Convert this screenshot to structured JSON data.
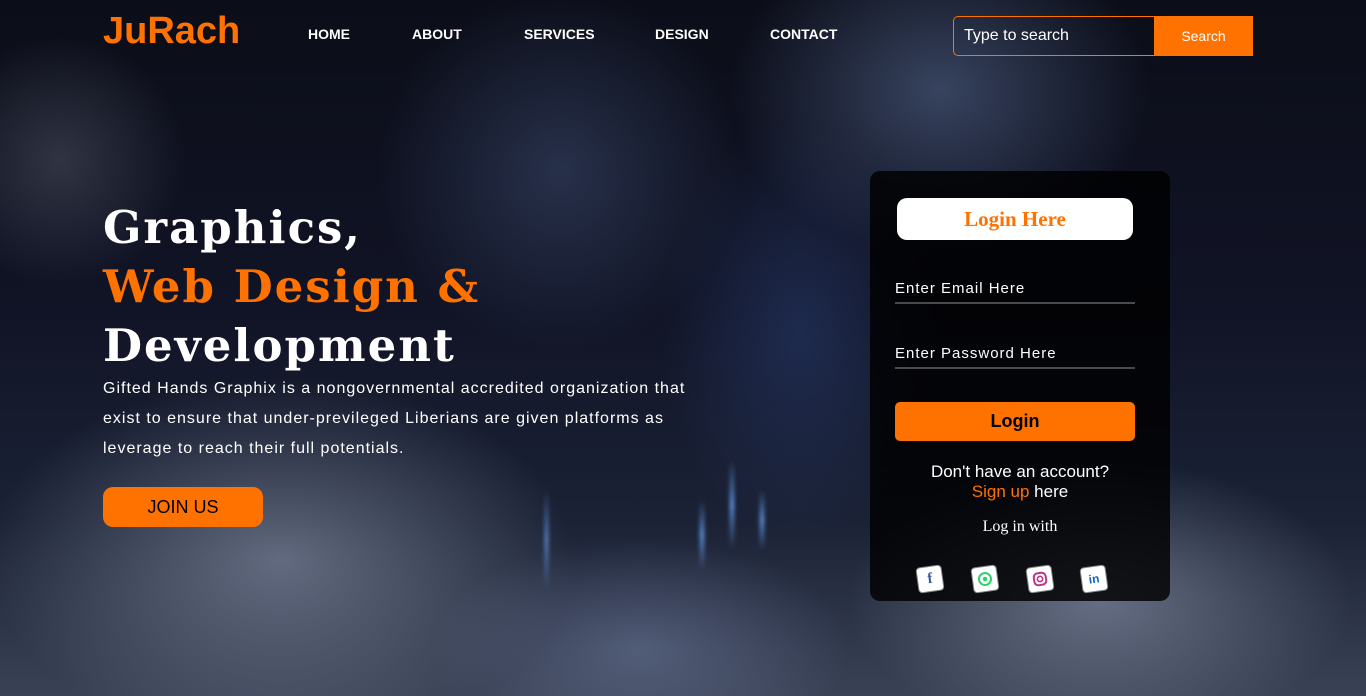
{
  "header": {
    "logo": "JuRach",
    "nav": [
      "HOME",
      "ABOUT",
      "SERVICES",
      "DESIGN",
      "CONTACT"
    ],
    "search_placeholder": "Type to search",
    "search_button": "Search"
  },
  "hero": {
    "line1": "Graphics,",
    "line2": "Web Design &",
    "line3": "Development",
    "paragraph": "Gifted Hands Graphix is a nongovernmental accredited organization that exist to ensure that under-previleged Liberians are given platforms as leverage to reach their full potentials.",
    "join_button": "JOIN US"
  },
  "login": {
    "title": "Login Here",
    "email_placeholder": "Enter Email Here",
    "password_placeholder": "Enter Password Here",
    "login_button": "Login",
    "no_account": "Don't have an account?",
    "signup_link": "Sign up",
    "signup_suffix": " here",
    "login_with": "Log in with",
    "social_icons": [
      "facebook-icon",
      "whatsapp-icon",
      "instagram-icon",
      "linkedin-icon"
    ]
  },
  "colors": {
    "accent": "#ff7200",
    "facebook": "#3b5998",
    "whatsapp": "#25d366",
    "instagram": "#c13584",
    "linkedin": "#0a66c2"
  }
}
